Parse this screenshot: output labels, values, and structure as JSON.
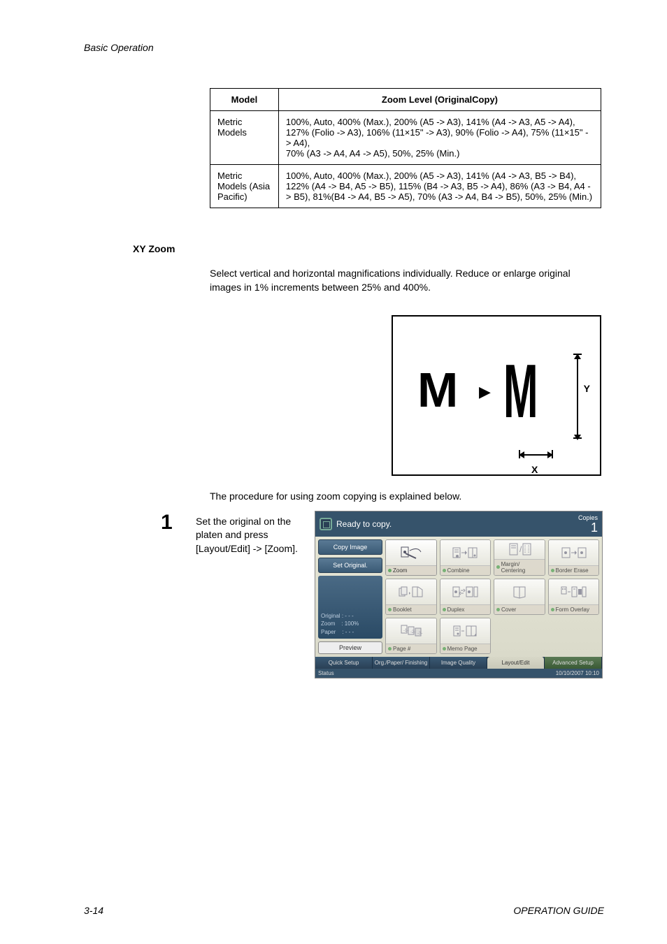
{
  "header": "Basic Operation",
  "table": {
    "head": {
      "c1": "Model",
      "c2": "Zoom Level (OriginalCopy)"
    },
    "rows": [
      {
        "c1": "Metric Models",
        "c2": "100%, Auto, 400% (Max.), 200% (A5 -> A3), 141% (A4 -> A3, A5 -> A4), 127% (Folio -> A3), 106% (11×15\" -> A3), 90% (Folio -> A4), 75% (11×15\" -> A4),\n70% (A3 -> A4, A4 -> A5), 50%, 25% (Min.)"
      },
      {
        "c1": "Metric Models (Asia Pacific)",
        "c2": "100%, Auto, 400% (Max.), 200% (A5 -> A3), 141% (A4 -> A3, B5 -> B4), 122% (A4 -> B4, A5 -> B5), 115% (B4 -> A3, B5 -> A4), 86% (A3 -> B4, A4 -> B5), 81%(B4 -> A4, B5 -> A5), 70% (A3 -> A4, B4 -> B5), 50%, 25% (Min.)"
      }
    ]
  },
  "section_heading": "XY Zoom",
  "intro_text": "Select vertical and horizontal magnifications individually. Reduce or enlarge original images in 1% increments between 25% and 400%.",
  "diagram": {
    "m1": "M",
    "m2": "M",
    "y": "Y",
    "x": "X",
    "arrow": "▶"
  },
  "procedure_text": "The procedure for using zoom copying is explained below.",
  "step": {
    "num": "1",
    "text": "Set the original on the platen and press [Layout/Edit] -> [Zoom]."
  },
  "panel": {
    "title": "Ready to copy.",
    "copies_label": "Copies",
    "copies_value": "1",
    "side": {
      "copy_image": "Copy Image",
      "set_original": "Set Original.",
      "original": "Original",
      "original_v": ": - - -",
      "zoom": "Zoom",
      "zoom_v": ": 100%",
      "paper": "Paper",
      "paper_v": ": - - -",
      "preview": "Preview"
    },
    "opts": {
      "zoom": "Zoom",
      "combine": "Combine",
      "margin": "Margin/ Centering",
      "border": "Border Erase",
      "booklet": "Booklet",
      "duplex": "Duplex",
      "cover": "Cover",
      "form": "Form Overlay",
      "page": "Page #",
      "memo": "Memo Page"
    },
    "tabs": {
      "quick": "Quick Setup",
      "org": "Org./Paper/ Finishing",
      "image": "Image Quality",
      "layout": "Layout/Edit",
      "adv": "Advanced Setup"
    },
    "status_left": "Status",
    "status_right": "10/10/2007   10:10"
  },
  "footer": {
    "page": "3-14",
    "guide": "OPERATION GUIDE"
  }
}
